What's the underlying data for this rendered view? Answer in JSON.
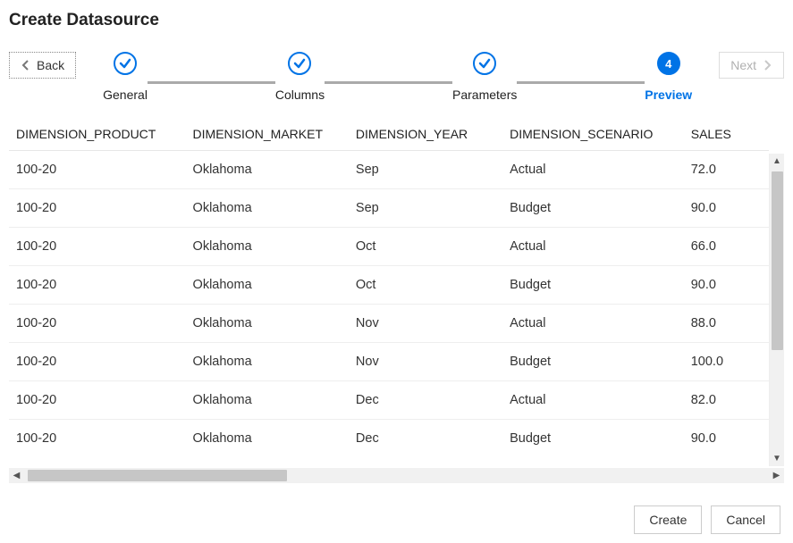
{
  "title": "Create Datasource",
  "nav": {
    "back": "Back",
    "next": "Next"
  },
  "steps": [
    {
      "label": "General",
      "state": "done"
    },
    {
      "label": "Columns",
      "state": "done"
    },
    {
      "label": "Parameters",
      "state": "done"
    },
    {
      "label": "Preview",
      "state": "active",
      "number": "4"
    }
  ],
  "table": {
    "columns": [
      "DIMENSION_PRODUCT",
      "DIMENSION_MARKET",
      "DIMENSION_YEAR",
      "DIMENSION_SCENARIO",
      "SALES"
    ],
    "rows": [
      {
        "product": "100-20",
        "market": "Oklahoma",
        "year": "Sep",
        "scenario": "Actual",
        "sales": "72.0"
      },
      {
        "product": "100-20",
        "market": "Oklahoma",
        "year": "Sep",
        "scenario": "Budget",
        "sales": "90.0"
      },
      {
        "product": "100-20",
        "market": "Oklahoma",
        "year": "Oct",
        "scenario": "Actual",
        "sales": "66.0"
      },
      {
        "product": "100-20",
        "market": "Oklahoma",
        "year": "Oct",
        "scenario": "Budget",
        "sales": "90.0"
      },
      {
        "product": "100-20",
        "market": "Oklahoma",
        "year": "Nov",
        "scenario": "Actual",
        "sales": "88.0"
      },
      {
        "product": "100-20",
        "market": "Oklahoma",
        "year": "Nov",
        "scenario": "Budget",
        "sales": "100.0"
      },
      {
        "product": "100-20",
        "market": "Oklahoma",
        "year": "Dec",
        "scenario": "Actual",
        "sales": "82.0"
      },
      {
        "product": "100-20",
        "market": "Oklahoma",
        "year": "Dec",
        "scenario": "Budget",
        "sales": "90.0"
      }
    ]
  },
  "footer": {
    "create": "Create",
    "cancel": "Cancel"
  }
}
